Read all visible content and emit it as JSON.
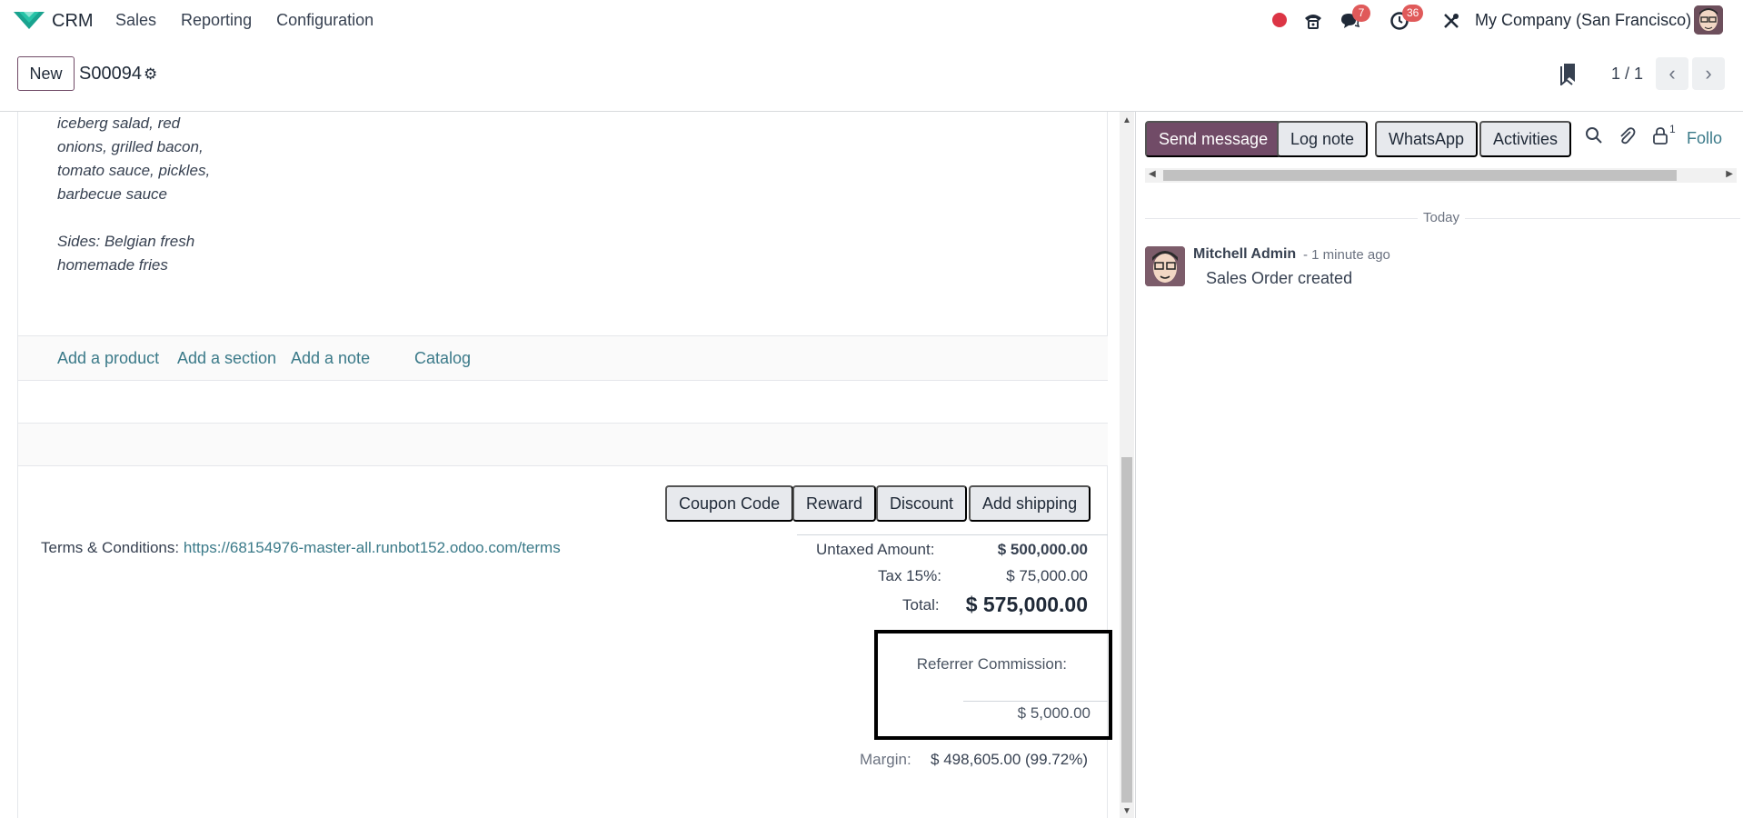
{
  "navbar": {
    "app_name": "CRM",
    "menu": [
      "Sales",
      "Reporting",
      "Configuration"
    ],
    "badges": {
      "messages": "7",
      "activities": "36"
    },
    "company": "My Company (San Francisco)",
    "icons": [
      "recording-dot-icon",
      "phone-icon",
      "chat-icon",
      "clock-icon",
      "tools-icon"
    ]
  },
  "control": {
    "new_label": "New",
    "record": "S00094",
    "pager": "1 / 1"
  },
  "form": {
    "description": [
      "iceberg salad, red",
      "onions, grilled bacon,",
      "tomato sauce, pickles,",
      "barbecue sauce",
      "",
      "Sides: Belgian fresh",
      "homemade fries"
    ],
    "add_line": {
      "product": "Add a product",
      "section": "Add a section",
      "note": "Add a note",
      "catalog": "Catalog"
    },
    "buttons": {
      "coupon": "Coupon Code",
      "reward": "Reward",
      "discount": "Discount",
      "shipping": "Add shipping"
    },
    "terms_label": "Terms & Conditions:",
    "terms_link": "https://68154976-master-all.runbot152.odoo.com/terms",
    "totals": {
      "untaxed_label": "Untaxed Amount:",
      "untaxed_value": "$ 500,000.00",
      "tax_label": "Tax 15%:",
      "tax_value": "$ 75,000.00",
      "total_label": "Total:",
      "total_value": "$ 575,000.00",
      "commission_label": "Referrer Commission:",
      "commission_value": "$ 5,000.00",
      "margin_label": "Margin:",
      "margin_value": "$ 498,605.00 (99.72%)"
    }
  },
  "chatter": {
    "send_message": "Send message",
    "log_note": "Log note",
    "whatsapp": "WhatsApp",
    "activities": "Activities",
    "followers_count": "1",
    "follow": "Follo",
    "date_separator": "Today",
    "message": {
      "author": "Mitchell Admin",
      "time": "- 1 minute ago",
      "body": "Sales Order created"
    }
  },
  "colors": {
    "primary": "#714b67",
    "link": "#3b7a89",
    "badge": "#e05a5a",
    "record_dot": "#dc3545"
  }
}
